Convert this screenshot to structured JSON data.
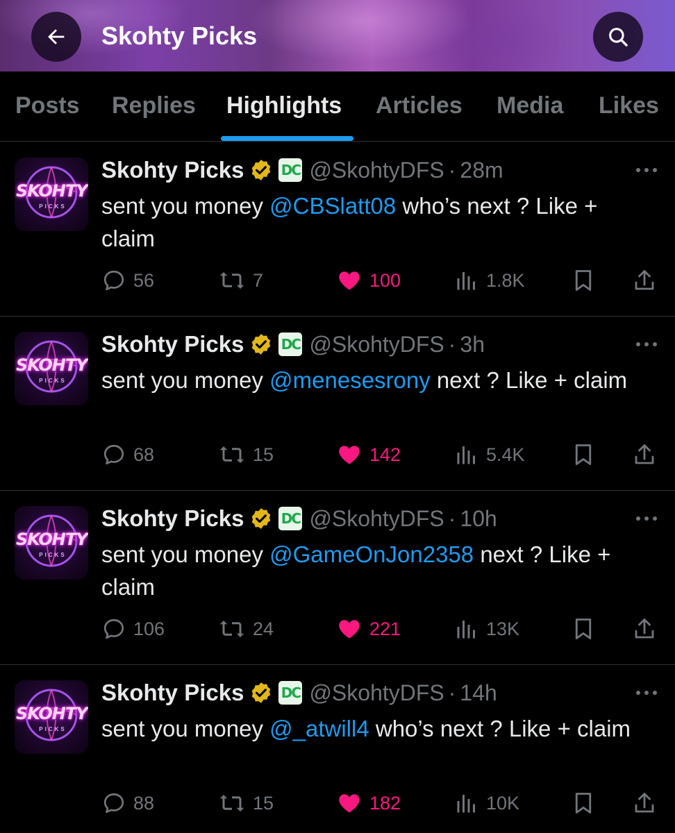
{
  "header": {
    "title": "Skohty Picks",
    "back_icon": "arrow-left-icon",
    "search_icon": "search-icon"
  },
  "tabs": [
    {
      "label": "Posts",
      "active": false
    },
    {
      "label": "Replies",
      "active": false
    },
    {
      "label": "Highlights",
      "active": true
    },
    {
      "label": "Articles",
      "active": false
    },
    {
      "label": "Media",
      "active": false
    },
    {
      "label": "Likes",
      "active": false
    }
  ],
  "colors": {
    "accent": "#1d9bf0",
    "like": "#f91880",
    "muted": "#71767b",
    "verified_gold": "#e2b719"
  },
  "avatar": {
    "text": "SKOHTY",
    "sub": "PICKS"
  },
  "badge": {
    "text": "DC"
  },
  "posts": [
    {
      "name": "Skohty Picks",
      "handle": "@SkohtyDFS",
      "dot": "·",
      "time": "28m",
      "text_before": "sent you money ",
      "mention": "@CBSlatt08",
      "text_after": " who’s next ? Like + claim",
      "replies": "56",
      "reposts": "7",
      "likes": "100",
      "views": "1.8K"
    },
    {
      "name": "Skohty Picks",
      "handle": "@SkohtyDFS",
      "dot": "·",
      "time": "3h",
      "text_before": "sent you money ",
      "mention": "@menesesrony",
      "text_after": " next ? Like + claim",
      "replies": "68",
      "reposts": "15",
      "likes": "142",
      "views": "5.4K"
    },
    {
      "name": "Skohty Picks",
      "handle": "@SkohtyDFS",
      "dot": "·",
      "time": "10h",
      "text_before": "sent you money ",
      "mention": "@GameOnJon2358",
      "text_after": " next ? Like + claim",
      "replies": "106",
      "reposts": "24",
      "likes": "221",
      "views": "13K"
    },
    {
      "name": "Skohty Picks",
      "handle": "@SkohtyDFS",
      "dot": "·",
      "time": "14h",
      "text_before": "sent you money ",
      "mention": "@_atwill4",
      "text_after": " who’s next ? Like + claim",
      "replies": "88",
      "reposts": "15",
      "likes": "182",
      "views": "10K"
    }
  ]
}
